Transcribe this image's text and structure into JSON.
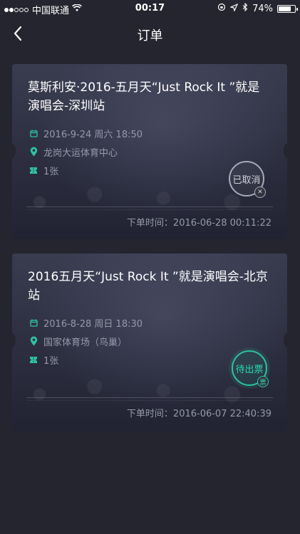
{
  "status_bar": {
    "carrier": "中国联通",
    "time": "00:17",
    "battery": "74%"
  },
  "nav": {
    "title": "订单",
    "back_icon": "chevron-left-icon"
  },
  "orders": [
    {
      "title": "莫斯利安·2016-五月天“Just Rock It ”就是演唱会-深圳站",
      "datetime": "2016-9-24 周六 18:50",
      "venue": "龙岗大运体育中心",
      "quantity": "1张",
      "status": "已取消",
      "order_time": "下单时间：2016-06-28 00:11:22"
    },
    {
      "title": "2016五月天“Just Rock It ”就是演唱会-北京站",
      "datetime": "2016-8-28 周日 18:30",
      "venue": "国家体育场（鸟巢）",
      "quantity": "1张",
      "status": "待出票",
      "order_time": "下单时间：2016-06-07 22:40:39"
    }
  ],
  "colors": {
    "accent": "#2bc4a0",
    "background": "#24252e",
    "card": "#33343f",
    "muted_text": "#9699a8"
  }
}
